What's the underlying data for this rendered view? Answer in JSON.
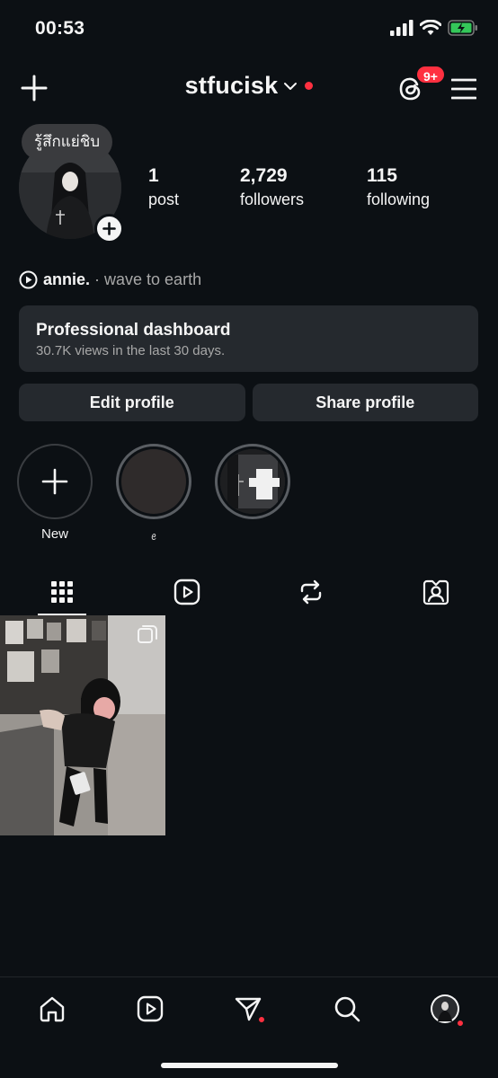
{
  "status_bar": {
    "time": "00:53",
    "icons": [
      "cellular-signal-icon",
      "wifi-icon",
      "battery-charging-icon"
    ]
  },
  "header": {
    "username": "stfucisk",
    "threads_badge": "9+",
    "icons": [
      "plus-icon",
      "chevron-down-icon",
      "threads-icon",
      "hamburger-menu-icon"
    ]
  },
  "profile": {
    "note": "รู้สึกแย่ชิบ",
    "stats": [
      {
        "value": "1",
        "label": "post"
      },
      {
        "value": "2,729",
        "label": "followers"
      },
      {
        "value": "115",
        "label": "following"
      }
    ],
    "music": {
      "song": "annie.",
      "separator": " · ",
      "artist": "wave to earth"
    }
  },
  "dashboard": {
    "title": "Professional dashboard",
    "subtitle": "30.7K views in the last 30 days."
  },
  "buttons": {
    "edit": "Edit profile",
    "share": "Share profile"
  },
  "highlights": [
    {
      "label": "New"
    },
    {
      "label": "ꫀ"
    },
    {
      "label": ""
    }
  ],
  "tabs": [
    "grid-icon",
    "reels-icon",
    "reposts-icon",
    "tagged-icon"
  ],
  "bottom_nav": [
    "home-icon",
    "reels-icon",
    "direct-messages-icon",
    "search-icon",
    "profile-avatar"
  ],
  "colors": {
    "background": "#0c1014",
    "surface": "#25292e",
    "text": "#f5f5f5",
    "muted": "#a8a8a8",
    "notification_red": "#ff3040"
  }
}
